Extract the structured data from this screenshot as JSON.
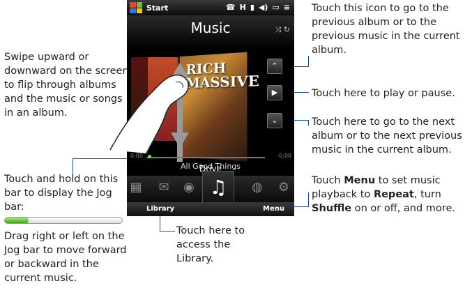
{
  "phone": {
    "start_label": "Start",
    "status_icons": [
      "☎",
      "H",
      "▮",
      "◀)",
      "▭",
      "≡"
    ],
    "header_title": "Music",
    "shuffle_repeat_icons": "⤨ ↻",
    "album_art_text": "RICH\nMASSIVE",
    "song_title": "Drive",
    "album_name": "All Good Things",
    "time_left": "0:00",
    "time_right": "-0:00",
    "progress": 0.05,
    "softkey_left": "Library",
    "softkey_right": "Menu",
    "dock_icons": [
      "message-icon",
      "mail-icon",
      "camera-icon",
      "music-icon",
      "internet-icon",
      "settings-icon"
    ]
  },
  "annotations": {
    "swipe": "Swipe upward or downward on the screen to flip through albums and the music or songs in an album.",
    "prev": "Touch this icon to go to the previous album or to the previous music in the current album.",
    "play": "Touch here to play or pause.",
    "next": "Touch here to go to the next album or to the next previous music in the current album.",
    "menu_part1": "Touch ",
    "menu_bold1": "Menu",
    "menu_part2": " to set music playback to ",
    "menu_bold2": "Repeat",
    "menu_part3": ", turn ",
    "menu_bold3": "Shuffle",
    "menu_part4": " on or off, and more.",
    "jog_hold": "Touch and hold on this bar to display the Jog bar:",
    "jog_drag": "Drag right or left on the Jog bar to move forward or backward in the current music.",
    "library": "Touch here to access the Library."
  },
  "jog_bar": {
    "fill": 0.2
  },
  "colors": {
    "leader_line": "#1a4f8c",
    "jog_green": "#39a414"
  }
}
